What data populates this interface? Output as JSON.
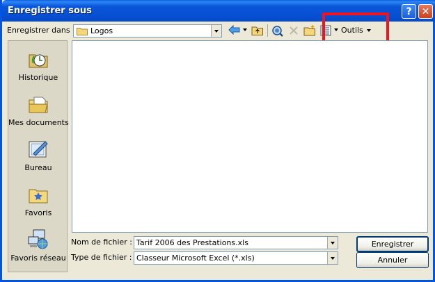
{
  "window": {
    "title": "Enregistrer sous"
  },
  "toolbar": {
    "save_in_label": "Enregistrer dans :",
    "save_in_value": "Logos",
    "tools_label": "Outils"
  },
  "places": [
    {
      "label": "Historique",
      "icon": "history-icon"
    },
    {
      "label": "Mes documents",
      "icon": "my-documents-icon"
    },
    {
      "label": "Bureau",
      "icon": "desktop-icon"
    },
    {
      "label": "Favoris",
      "icon": "favorites-icon"
    },
    {
      "label": "Favoris réseau",
      "icon": "network-places-icon"
    }
  ],
  "form": {
    "filename_label": "Nom de fichier :",
    "filename_value": "Tarif 2006 des Prestations.xls",
    "filetype_label": "Type de fichier :",
    "filetype_value": "Classeur Microsoft Excel (*.xls)"
  },
  "buttons": {
    "save": "Enregistrer",
    "cancel": "Annuler"
  },
  "colors": {
    "title_bar": "#0750D4",
    "highlight_box": "#F0141E"
  }
}
